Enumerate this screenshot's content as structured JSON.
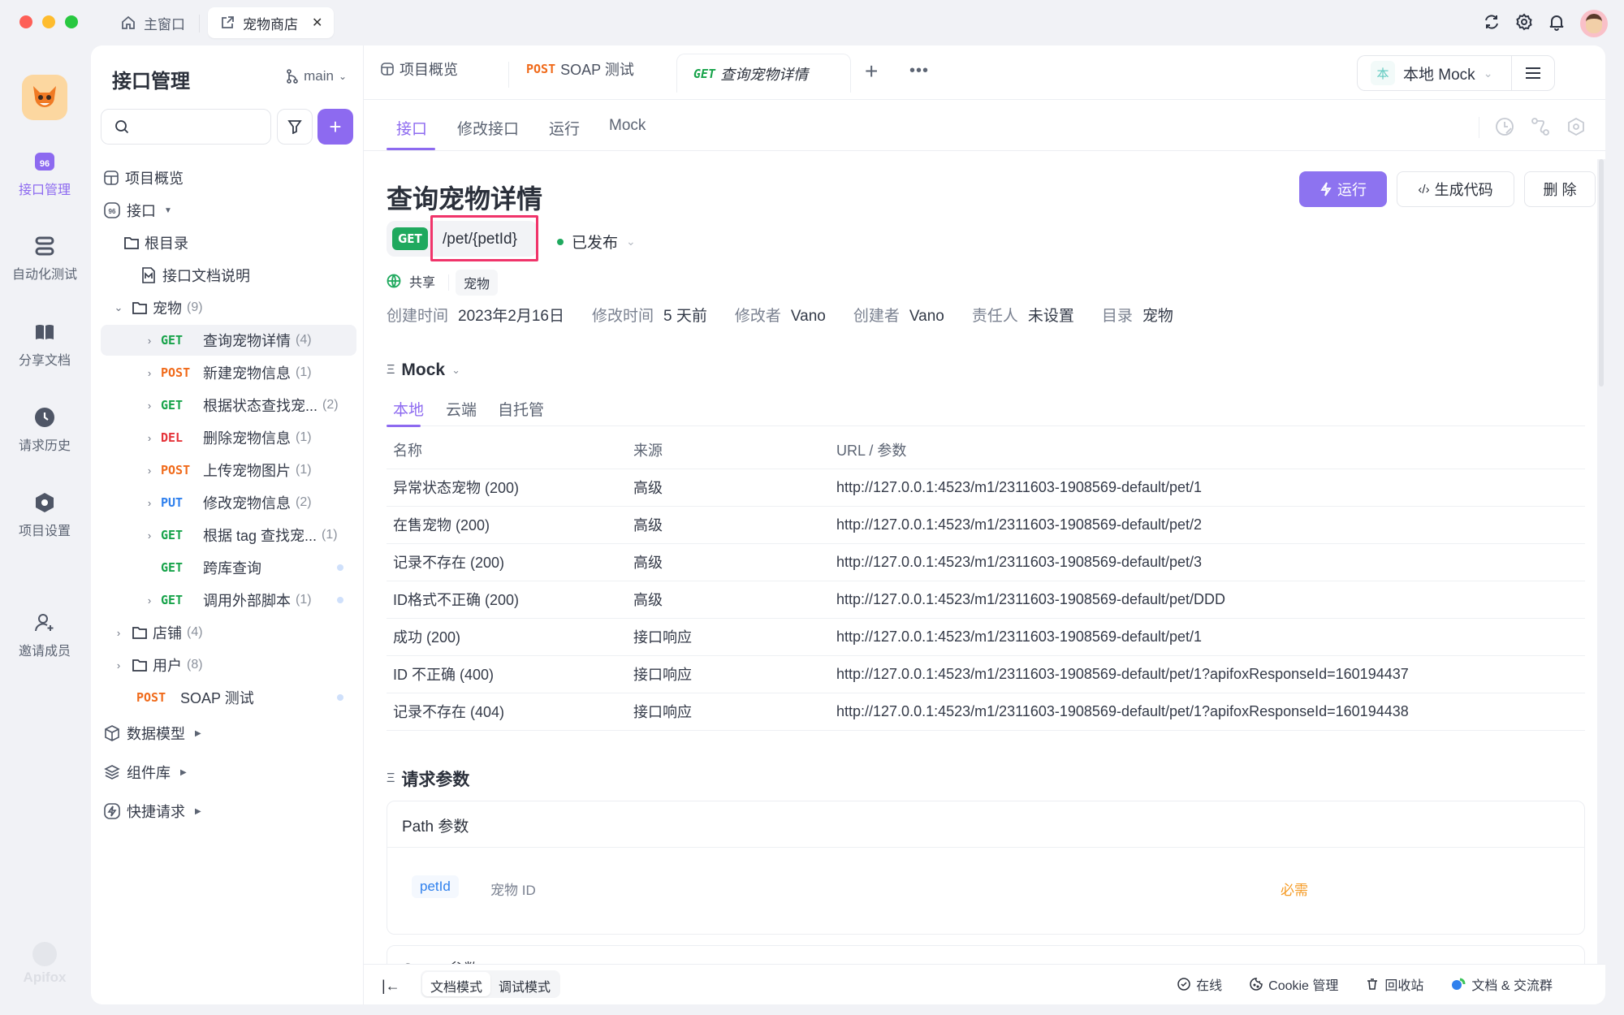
{
  "titlebar": {
    "tabs": [
      {
        "label": "主窗口",
        "icon": "home-icon"
      },
      {
        "label": "宠物商店",
        "icon": "external-link-icon"
      }
    ],
    "close_label": "✕",
    "icons": [
      "refresh-icon",
      "gear-icon",
      "bell-icon",
      "avatar"
    ]
  },
  "rail": {
    "items": [
      {
        "label": "接口管理",
        "icon": "api-icon",
        "active": true
      },
      {
        "label": "自动化测试",
        "icon": "automation-icon"
      },
      {
        "label": "分享文档",
        "icon": "book-icon"
      },
      {
        "label": "请求历史",
        "icon": "clock-icon"
      },
      {
        "label": "项目设置",
        "icon": "settings-hex-icon"
      },
      {
        "label": "邀请成员",
        "icon": "add-user-icon"
      }
    ],
    "brand": "Apifox"
  },
  "tree": {
    "title": "接口管理",
    "branch": "main",
    "search_placeholder": "",
    "items": [
      {
        "label": "项目概览",
        "type": "overview"
      },
      {
        "label": "接口",
        "type": "section"
      },
      {
        "label": "根目录",
        "type": "root"
      },
      {
        "label": "接口文档说明",
        "type": "doc"
      },
      {
        "label": "宠物",
        "count": "(9)",
        "type": "folder-open"
      },
      {
        "method": "GET",
        "label": "查询宠物详情",
        "count": "(4)",
        "selected": true
      },
      {
        "method": "POST",
        "label": "新建宠物信息",
        "count": "(1)"
      },
      {
        "method": "GET",
        "label": "根据状态查找宠...",
        "count": "(2)"
      },
      {
        "method": "DEL",
        "label": "删除宠物信息",
        "count": "(1)"
      },
      {
        "method": "POST",
        "label": "上传宠物图片",
        "count": "(1)"
      },
      {
        "method": "PUT",
        "label": "修改宠物信息",
        "count": "(2)"
      },
      {
        "method": "GET",
        "label": "根据 tag 查找宠...",
        "count": "(1)"
      },
      {
        "method": "GET",
        "label": "跨库查询",
        "count": ""
      },
      {
        "method": "GET",
        "label": "调用外部脚本",
        "count": "(1)"
      },
      {
        "label": "店铺",
        "count": "(4)",
        "type": "folder"
      },
      {
        "label": "用户",
        "count": "(8)",
        "type": "folder"
      },
      {
        "method": "POST",
        "label": "SOAP 测试",
        "count": ""
      },
      {
        "label": "数据模型",
        "type": "section2"
      },
      {
        "label": "组件库",
        "type": "section2"
      },
      {
        "label": "快捷请求",
        "type": "section2"
      }
    ]
  },
  "colors": {
    "accent": "#8d6af0",
    "get": "#17a34a",
    "post": "#f06a1a",
    "del": "#e5343a",
    "put": "#2f80ed",
    "highlight_box": "#f0346a",
    "required": "#f59a23"
  },
  "main": {
    "tabs": [
      {
        "label": "项目概览",
        "method": ""
      },
      {
        "label": "SOAP 测试",
        "method": "POST"
      },
      {
        "label": "查询宠物详情",
        "method": "GET"
      }
    ],
    "env": {
      "badge": "本",
      "label": "本地 Mock"
    },
    "subtabs": [
      "接口",
      "修改接口",
      "运行",
      "Mock"
    ],
    "title": "查询宠物详情",
    "method": "GET",
    "path": "/pet/{petId}",
    "status": "已发布",
    "share_label": "共享",
    "tag": "宠物",
    "buttons": {
      "run": "运行",
      "gen": "生成代码",
      "delete": "删 除"
    },
    "meta": [
      {
        "k": "创建时间",
        "v": "2023年2月16日"
      },
      {
        "k": "修改时间",
        "v": "5 天前"
      },
      {
        "k": "修改者",
        "v": "Vano"
      },
      {
        "k": "创建者",
        "v": "Vano"
      },
      {
        "k": "责任人",
        "v": "未设置"
      },
      {
        "k": "目录",
        "v": "宠物"
      }
    ],
    "mock": {
      "heading": "Mock",
      "tabs": [
        "本地",
        "云端",
        "自托管"
      ],
      "columns": [
        "名称",
        "来源",
        "URL / 参数"
      ],
      "rows": [
        [
          "异常状态宠物 (200)",
          "高级",
          "http://127.0.0.1:4523/m1/2311603-1908569-default/pet/1"
        ],
        [
          "在售宠物 (200)",
          "高级",
          "http://127.0.0.1:4523/m1/2311603-1908569-default/pet/2"
        ],
        [
          "记录不存在 (200)",
          "高级",
          "http://127.0.0.1:4523/m1/2311603-1908569-default/pet/3"
        ],
        [
          "ID格式不正确 (200)",
          "高级",
          "http://127.0.0.1:4523/m1/2311603-1908569-default/pet/DDD"
        ],
        [
          "成功 (200)",
          "接口响应",
          "http://127.0.0.1:4523/m1/2311603-1908569-default/pet/1"
        ],
        [
          "ID 不正确 (400)",
          "接口响应",
          "http://127.0.0.1:4523/m1/2311603-1908569-default/pet/1?apifoxResponseId=160194437"
        ],
        [
          "记录不存在 (404)",
          "接口响应",
          "http://127.0.0.1:4523/m1/2311603-1908569-default/pet/1?apifoxResponseId=160194438"
        ]
      ]
    },
    "params": {
      "heading": "请求参数",
      "path_title": "Path 参数",
      "param_name": "petId",
      "param_desc": "宠物 ID",
      "required": "必需",
      "next_title": "Query 参数"
    },
    "footer": {
      "modes": [
        "文档模式",
        "调试模式"
      ],
      "right": [
        "在线",
        "Cookie 管理",
        "回收站",
        "文档 & 交流群"
      ]
    }
  }
}
